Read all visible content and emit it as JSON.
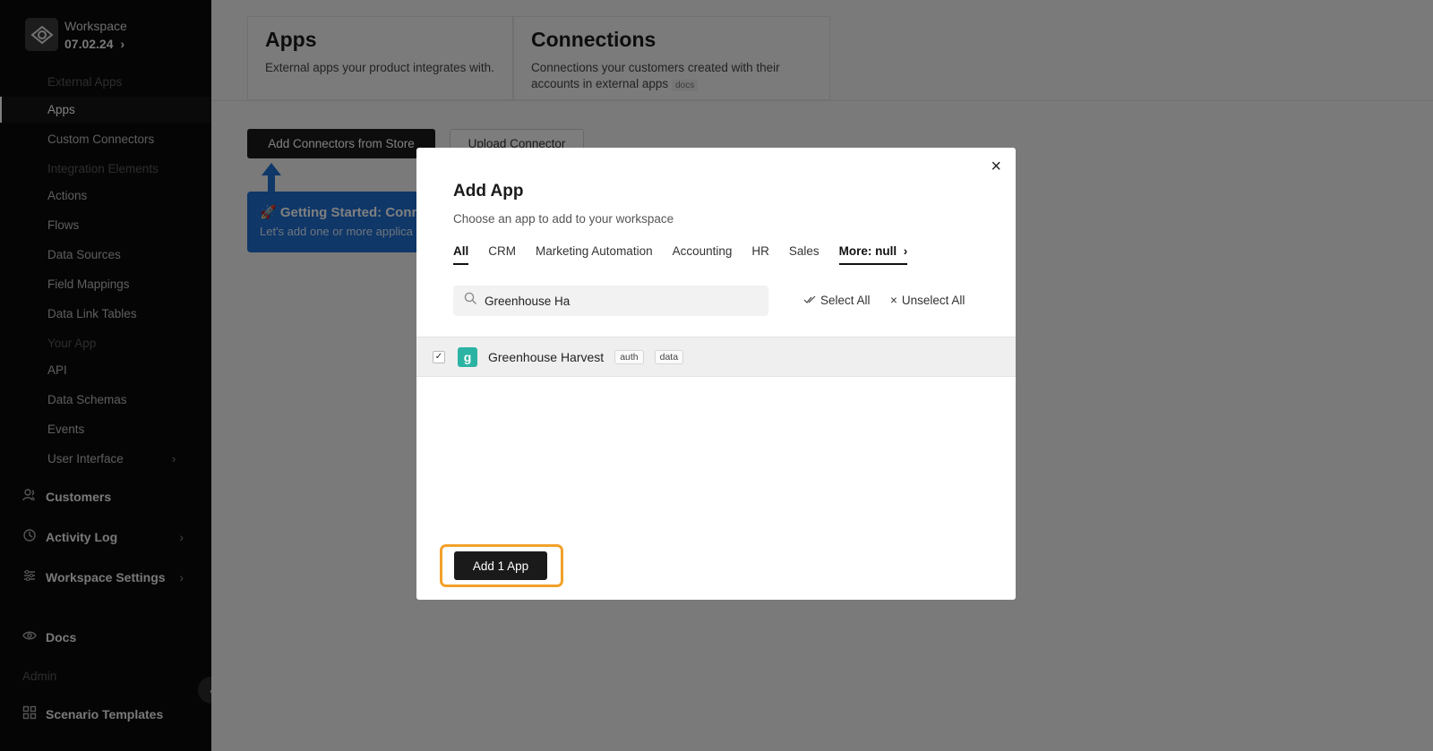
{
  "workspace": {
    "name": "Workspace",
    "version": "07.02.24"
  },
  "sidebar": {
    "section_external": "External Apps",
    "apps": "Apps",
    "custom_connectors": "Custom Connectors",
    "section_integration": "Integration Elements",
    "actions": "Actions",
    "flows": "Flows",
    "data_sources": "Data Sources",
    "field_mappings": "Field Mappings",
    "data_link_tables": "Data Link Tables",
    "section_your_app": "Your App",
    "api": "API",
    "data_schemas": "Data Schemas",
    "events": "Events",
    "user_interface": "User Interface",
    "customers": "Customers",
    "activity_log": "Activity Log",
    "workspace_settings": "Workspace Settings",
    "docs": "Docs",
    "section_admin": "Admin",
    "scenario_templates": "Scenario Templates"
  },
  "page_tabs": {
    "apps_title": "Apps",
    "apps_desc": "External apps your product integrates with.",
    "conn_title": "Connections",
    "conn_desc": "Connections your customers created with their accounts in external apps",
    "docs_tag": "docs"
  },
  "toolbar": {
    "store_label": "Add Connectors from Store",
    "upload_label": "Upload Connector"
  },
  "getting_started": {
    "title": "🚀 Getting Started: Conn",
    "text": "Let's add one or more applica"
  },
  "modal": {
    "title": "Add App",
    "subtitle": "Choose an app to add to your workspace",
    "tabs": [
      "All",
      "CRM",
      "Marketing Automation",
      "Accounting",
      "HR",
      "Sales"
    ],
    "more_tab": "More: null",
    "search_value": "Greenhouse Ha",
    "select_all": "Select All",
    "unselect_all": "Unselect All",
    "app": {
      "name": "Greenhouse Harvest",
      "tags": [
        "auth",
        "data"
      ],
      "icon_letter": "g"
    },
    "add_button": "Add 1 App"
  }
}
